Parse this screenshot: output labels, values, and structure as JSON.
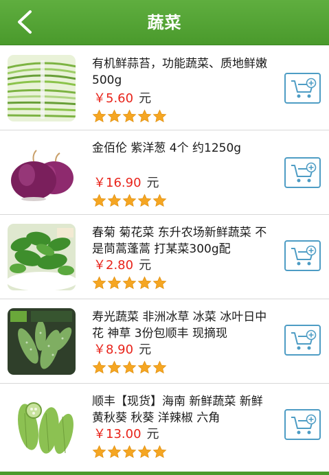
{
  "header": {
    "title": "蔬菜",
    "back_icon": "chevron-left-icon"
  },
  "theme": {
    "header_green": "#4a9a2c",
    "price_red": "#e8231a",
    "star_orange": "#f5a623",
    "cart_blue": "#4d9cc4"
  },
  "products": [
    {
      "name": "有机鲜蒜苔，功能蔬菜、质地鲜嫩 500g",
      "price": "￥5.60",
      "unit": "元",
      "rating": 5,
      "image": "garlic-sprout-photo",
      "cart_icon": "add-to-cart-icon"
    },
    {
      "name": "金佰伦 紫洋葱 4个 约1250g",
      "price": "￥16.90",
      "unit": "元",
      "rating": 5,
      "image": "purple-onion-photo",
      "cart_icon": "add-to-cart-icon"
    },
    {
      "name": "春菊 菊花菜 东升农场新鲜蔬菜 不是茼蒿蓬蒿 打某菜300g配",
      "price": "￥2.80",
      "unit": "元",
      "rating": 5,
      "image": "chrysanthemum-greens-photo",
      "cart_icon": "add-to-cart-icon"
    },
    {
      "name": "寿光蔬菜 非洲冰草 冰菜 冰叶日中花 神草 3份包顺丰 现摘现",
      "price": "￥8.90",
      "unit": "元",
      "rating": 5,
      "image": "ice-plant-photo",
      "cart_icon": "add-to-cart-icon"
    },
    {
      "name": "顺丰【现货】海南 新鲜蔬菜 新鲜黄秋葵 秋葵 洋辣椒 六角",
      "price": "￥13.00",
      "unit": "元",
      "rating": 5,
      "image": "okra-photo",
      "cart_icon": "add-to-cart-icon"
    }
  ]
}
